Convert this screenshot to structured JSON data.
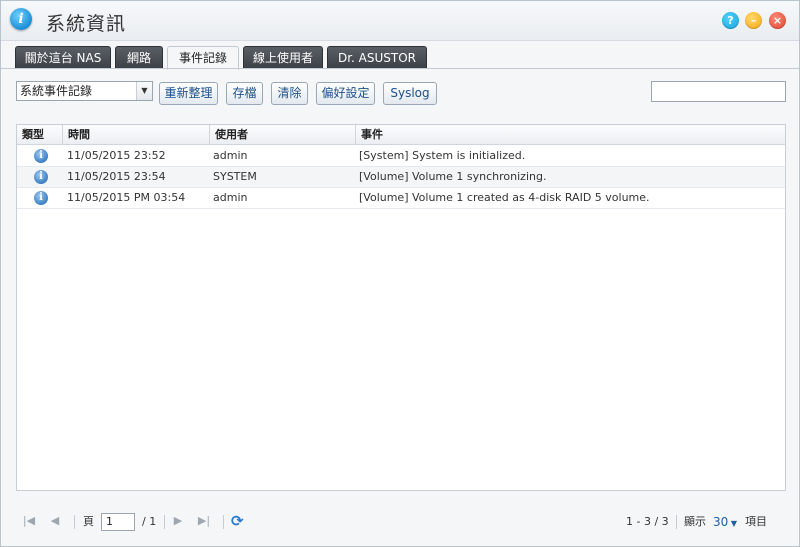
{
  "window": {
    "title": "系統資訊",
    "icons": {
      "app": "info-icon",
      "help": "help-icon",
      "minimize": "minimize-icon",
      "close": "close-icon"
    },
    "colors": {
      "help": "#16a0d9",
      "minimize": "#f3a50f",
      "close": "#e0412c"
    }
  },
  "tabs": [
    {
      "label": "關於這台 NAS",
      "active": false
    },
    {
      "label": "網路",
      "active": false
    },
    {
      "label": "事件記錄",
      "active": true
    },
    {
      "label": "線上使用者",
      "active": false
    },
    {
      "label": "Dr. ASUSTOR",
      "active": false
    }
  ],
  "toolbar": {
    "log_type_selected": "系統事件記錄",
    "refresh_label": "重新整理",
    "save_label": "存檔",
    "clear_label": "清除",
    "preferences_label": "偏好設定",
    "syslog_label": "Syslog",
    "search_value": ""
  },
  "table": {
    "columns": [
      "類型",
      "時間",
      "使用者",
      "事件"
    ],
    "rows": [
      {
        "type_icon": "info-icon",
        "time": "11/05/2015 23:52",
        "user": "admin",
        "event": "[System] System is initialized."
      },
      {
        "type_icon": "info-icon",
        "time": "11/05/2015 23:54",
        "user": "SYSTEM",
        "event": "[Volume] Volume 1 synchronizing."
      },
      {
        "type_icon": "info-icon",
        "time": "11/05/2015 PM 03:54",
        "user": "admin",
        "event": "[Volume] Volume 1 created as 4-disk RAID 5 volume."
      }
    ]
  },
  "pager": {
    "page_label": "頁",
    "current_page": "1",
    "total_pages": "/ 1",
    "range": "1 - 3 / 3",
    "show_label": "顯示",
    "per_page": "30",
    "items_label": "項目"
  }
}
